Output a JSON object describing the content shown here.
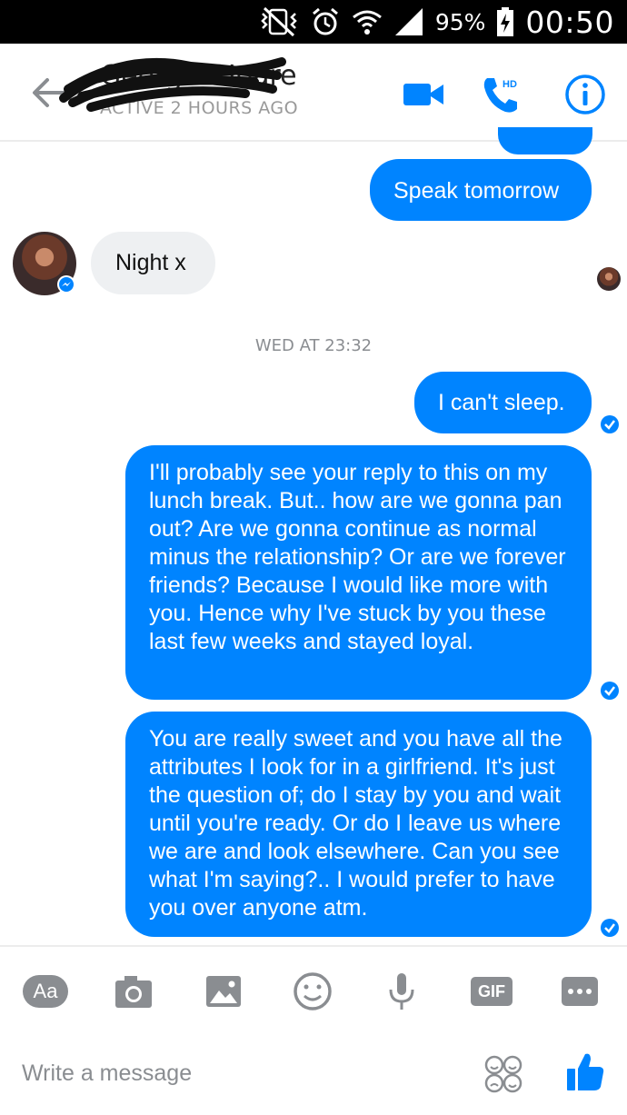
{
  "status_bar": {
    "battery": "95%",
    "time": "00:50"
  },
  "header": {
    "contact_name": "Georgia Hoare",
    "contact_status": "ACTIVE 2 HOURS AGO"
  },
  "messages": [
    {
      "from": "me",
      "text": "Speak tomorrow"
    },
    {
      "from": "them",
      "text": "Night x"
    },
    {
      "from": "me",
      "text": "I can't sleep."
    },
    {
      "from": "me",
      "text": "I'll probably see your reply to this on my lunch break. But.. how are we gonna pan out? Are we gonna continue as normal minus the relationship? Or are we forever friends? Because I would like more with you. Hence why I've stuck by you these last few weeks and stayed loyal."
    },
    {
      "from": "me",
      "text": "You are really sweet and you have all the attributes I look for in a girlfriend. It's just the question of; do I stay by you and wait until you're ready. Or do I leave us where we are and look elsewhere. Can you see what I'm saying?.. I would prefer to have you over anyone atm."
    }
  ],
  "timestamp": "WED AT 23:32",
  "composer": {
    "aa_label": "Aa",
    "gif_label": "GIF",
    "placeholder": "Write a message"
  },
  "colors": {
    "accent": "#0084ff",
    "incoming_bubble": "#eef0f2"
  }
}
